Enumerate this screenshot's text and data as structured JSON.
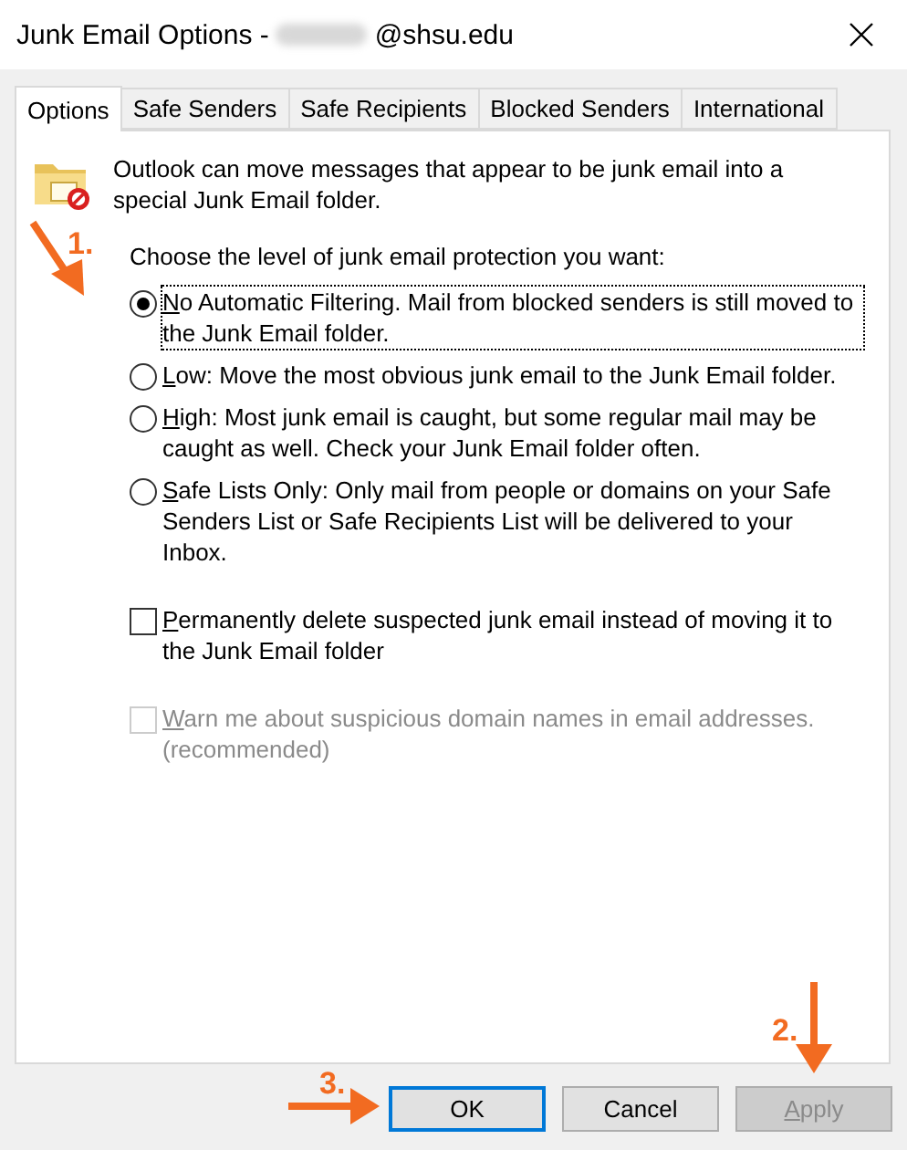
{
  "window": {
    "title": "Junk Email Options -",
    "title_suffix": "@shsu.edu"
  },
  "tabs": [
    {
      "label": "Options",
      "selected": true
    },
    {
      "label": "Safe Senders",
      "selected": false
    },
    {
      "label": "Safe Recipients",
      "selected": false
    },
    {
      "label": "Blocked Senders",
      "selected": false
    },
    {
      "label": "International",
      "selected": false
    }
  ],
  "intro": "Outlook can move messages that appear to be junk email into a special Junk Email folder.",
  "prompt": "Choose the level of junk email protection you want:",
  "levels": [
    {
      "label": "No Automatic Filtering. Mail from blocked senders is still moved to the Junk Email folder.",
      "selected": true,
      "focused": true
    },
    {
      "label": "Low: Move the most obvious junk email to the Junk Email folder.",
      "selected": false,
      "focused": false
    },
    {
      "label": "High: Most junk email is caught, but some regular mail may be caught as well. Check your Junk Email folder often.",
      "selected": false,
      "focused": false
    },
    {
      "label": "Safe Lists Only: Only mail from people or domains on your Safe Senders List or Safe Recipients List will be delivered to your Inbox.",
      "selected": false,
      "focused": false
    }
  ],
  "options": [
    {
      "label": "Permanently delete suspected junk email instead of moving it to the Junk Email folder",
      "checked": false,
      "disabled": false
    },
    {
      "label": "Warn me about suspicious domain names in email addresses. (recommended)",
      "checked": false,
      "disabled": true
    }
  ],
  "buttons": [
    {
      "label": "OK",
      "default": true,
      "disabled": false
    },
    {
      "label": "Cancel",
      "default": false,
      "disabled": false
    },
    {
      "label": "Apply",
      "default": false,
      "disabled": true
    }
  ],
  "annotations": [
    {
      "label": "1.",
      "kind": "diagonal"
    },
    {
      "label": "2.",
      "kind": "down"
    },
    {
      "label": "3.",
      "kind": "right"
    }
  ]
}
